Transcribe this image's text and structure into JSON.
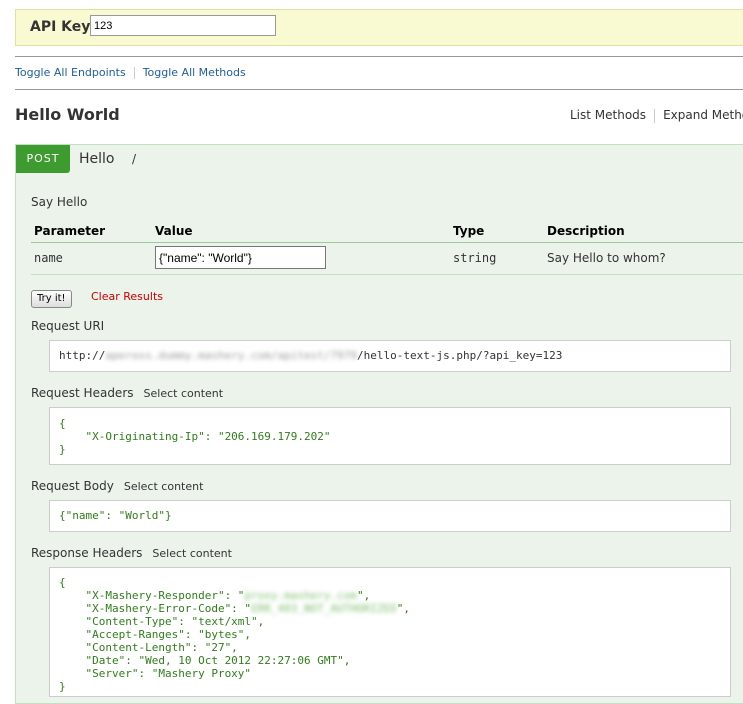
{
  "api_key": {
    "label": "API Key:",
    "value": "123"
  },
  "top_links": {
    "toggle_endpoints": "Toggle All Endpoints",
    "toggle_methods": "Toggle All Methods"
  },
  "resource": {
    "title": "Hello World",
    "list_methods": "List Methods",
    "expand_methods": "Expand Methods"
  },
  "operation": {
    "method": "POST",
    "name": "Hello",
    "path": "/",
    "description": "Say Hello",
    "columns": [
      "Parameter",
      "Value",
      "Type",
      "Description"
    ],
    "params": [
      {
        "name": "name",
        "value": "{\"name\": \"World\"}",
        "type": "string",
        "description": "Say Hello to whom?"
      }
    ],
    "try_label": "Try it!",
    "clear_label": "Clear Results"
  },
  "results": {
    "select_content": "Select content",
    "request_uri": {
      "label": "Request URI",
      "prefix": "http://",
      "redacted": "apeross.dummy.mashery.com/apitest/7979",
      "suffix": "/hello-text-js.php/?api_key=123"
    },
    "request_headers": {
      "label": "Request Headers",
      "lines": [
        "{",
        "    \"X-Originating-Ip\": \"206.169.179.202\"",
        "}"
      ]
    },
    "request_body": {
      "label": "Request Body",
      "text": "{\"name\": \"World\"}"
    },
    "response_headers": {
      "label": "Response Headers",
      "open": "{",
      "lines": [
        {
          "key": "    \"X-Mashery-Responder\": \"",
          "redacted": "proxy.mashery.com",
          "tail": "\","
        },
        {
          "key": "    \"X-Mashery-Error-Code\": \"",
          "redacted": "ERR_403_NOT_AUTHORIZED",
          "tail": "\","
        },
        {
          "key": "    \"Content-Type\": \"text/xml\",",
          "redacted": "",
          "tail": ""
        },
        {
          "key": "    \"Accept-Ranges\": \"bytes\",",
          "redacted": "",
          "tail": ""
        },
        {
          "key": "    \"Content-Length\": \"27\",",
          "redacted": "",
          "tail": ""
        },
        {
          "key": "    \"Date\": \"Wed, 10 Oct 2012 22:27:06 GMT\",",
          "redacted": "",
          "tail": ""
        },
        {
          "key": "    \"Server\": \"Mashery Proxy\"",
          "redacted": "",
          "tail": ""
        }
      ],
      "close": "}"
    }
  }
}
